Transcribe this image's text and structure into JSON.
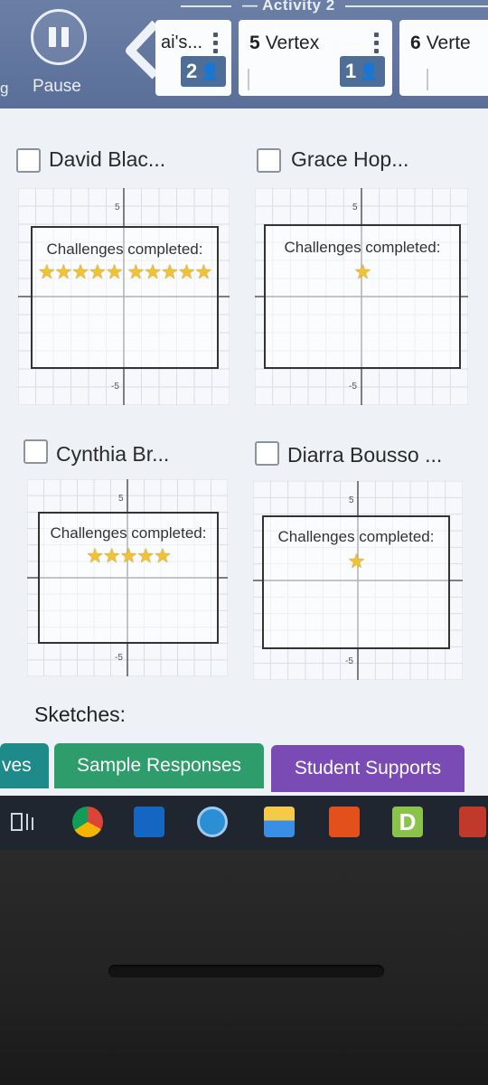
{
  "header": {
    "activity_label": "— Activity 2",
    "pause_label": "Pause",
    "left_cut_text": "g",
    "cards": [
      {
        "title_partial": "ai's",
        "suffix": "...",
        "count": "2"
      },
      {
        "num": "5",
        "title": "Vertex",
        "count": "1"
      },
      {
        "num": "6",
        "title": "Verte"
      }
    ]
  },
  "students": [
    {
      "name": "David Blac...",
      "label": "Challenges completed:",
      "stars": "★★★★★ ★★★★★"
    },
    {
      "name": "Grace Hop...",
      "label": "Challenges completed:",
      "stars": "★"
    },
    {
      "name": "Cynthia Br...",
      "label": "Challenges completed:",
      "stars": "★★★★★"
    },
    {
      "name": "Diarra Bousso ...",
      "label": "Challenges completed:",
      "stars": "★"
    }
  ],
  "axis_ticks": {
    "pos": "5",
    "neg": "-5"
  },
  "sketches_label": "Sketches:",
  "tabs": {
    "moves": "ves",
    "sample_responses": "Sample Responses",
    "student_supports": "Student Supports"
  },
  "colors": {
    "header_bg": "#5f739c",
    "sample_tab": "#2e9d6b",
    "supports_tab": "#7b4bb5",
    "star": "#f1c232"
  },
  "taskbar": {
    "icons": [
      "task-view-icon",
      "chrome-icon",
      "outlook-icon",
      "screen-share-icon",
      "file-explorer-icon",
      "office-icon",
      "desmos-icon",
      "snip-tool-icon"
    ],
    "desmos_letter": "D"
  }
}
